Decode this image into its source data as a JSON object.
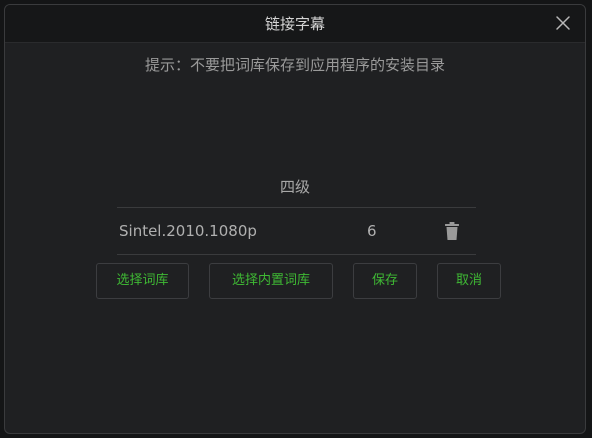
{
  "dialog": {
    "title": "链接字幕",
    "close_icon": "close-icon"
  },
  "hint": "提示：不要把词库保存到应用程序的安装目录",
  "section": {
    "title": "四级"
  },
  "table": {
    "rows": [
      {
        "name": "Sintel.2010.1080p",
        "count": "6",
        "action_icon": "trash-icon"
      }
    ]
  },
  "buttons": {
    "choose_library": "选择词库",
    "choose_builtin_library": "选择内置词库",
    "save": "保存",
    "cancel": "取消"
  },
  "colors": {
    "background": "#1f2022",
    "titlebar": "#161718",
    "accent_green": "#3fb934",
    "text_muted": "#9a9a9a",
    "border": "#3a3b3d"
  }
}
